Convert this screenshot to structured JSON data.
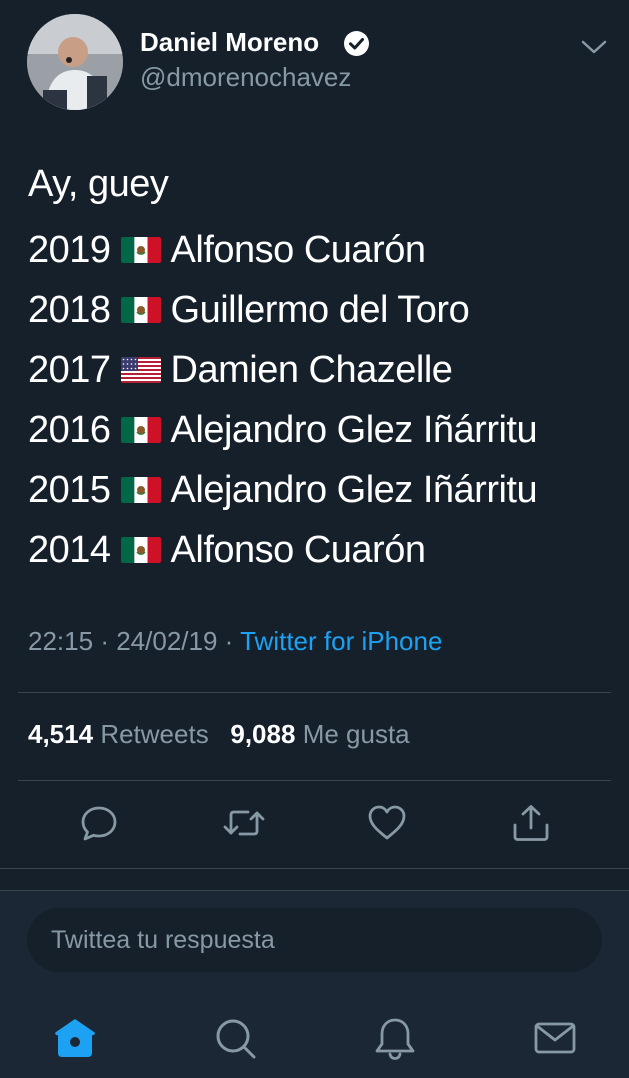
{
  "author": {
    "display_name": "Daniel Moreno",
    "handle": "@dmorenochavez",
    "verified": true
  },
  "tweet": {
    "intro": "Ay, guey",
    "winners": [
      {
        "year": "2019",
        "flag": "mexico-flag-icon",
        "name": "Alfonso Cuarón"
      },
      {
        "year": "2018",
        "flag": "mexico-flag-icon",
        "name": "Guillermo del Toro"
      },
      {
        "year": "2017",
        "flag": "usa-flag-icon",
        "name": "Damien Chazelle"
      },
      {
        "year": "2016",
        "flag": "mexico-flag-icon",
        "name": "Alejandro Glez Iñárritu"
      },
      {
        "year": "2015",
        "flag": "mexico-flag-icon",
        "name": "Alejandro Glez Iñárritu"
      },
      {
        "year": "2014",
        "flag": "mexico-flag-icon",
        "name": "Alfonso Cuarón"
      }
    ],
    "time": "22:15",
    "date": "24/02/19",
    "separator": "·",
    "source": "Twitter for iPhone"
  },
  "stats": {
    "retweets_count": "4,514",
    "retweets_label": "Retweets",
    "likes_count": "9,088",
    "likes_label": "Me gusta"
  },
  "actions": [
    "reply-icon",
    "retweet-icon",
    "like-icon",
    "share-icon"
  ],
  "reply": {
    "placeholder": "Twittea tu respuesta"
  },
  "bottom_nav": [
    "home-icon",
    "search-icon",
    "notifications-icon",
    "messages-icon"
  ],
  "colors": {
    "background": "#15202b",
    "link": "#1da1f2",
    "secondary_text": "#8899a6",
    "divider": "#38444d",
    "reply_bar": "#1b2735"
  }
}
